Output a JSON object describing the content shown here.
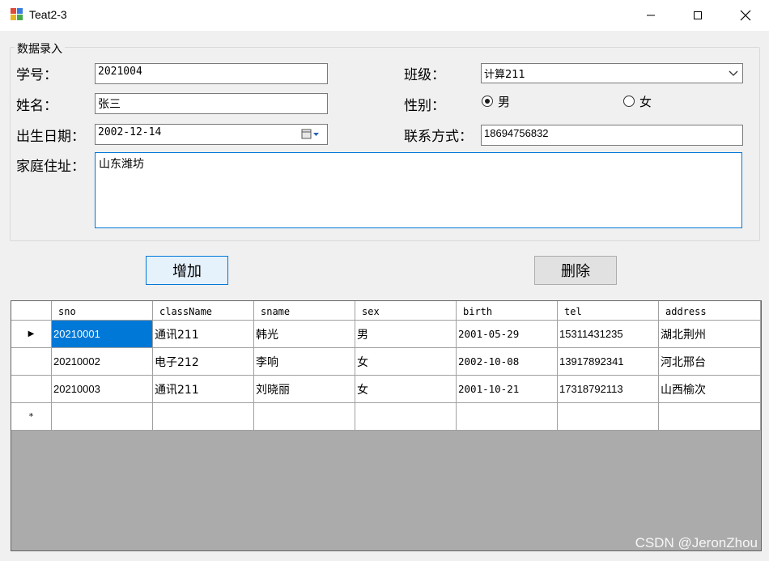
{
  "window": {
    "title": "Teat2-3",
    "icon": "winforms-app-icon"
  },
  "group": {
    "legend": "数据录入"
  },
  "form": {
    "sno_label": "学号：",
    "sno_value": "2021004",
    "name_label": "姓名：",
    "name_value": "张三",
    "birth_label": "出生日期：",
    "birth_value": "2002-12-14",
    "address_label": "家庭住址：",
    "address_value": "山东潍坊",
    "class_label": "班级：",
    "class_value": "计算211",
    "sex_label": "性别：",
    "sex_options": [
      {
        "label": "男",
        "checked": true
      },
      {
        "label": "女",
        "checked": false
      }
    ],
    "tel_label": "联系方式：",
    "tel_value": "18694756832"
  },
  "buttons": {
    "add": "增加",
    "delete": "删除"
  },
  "grid": {
    "columns": [
      "sno",
      "className",
      "sname",
      "sex",
      "birth",
      "tel",
      "address"
    ],
    "rows": [
      [
        "20210001",
        "通讯211",
        "韩光",
        "男",
        "2001-05-29",
        "15311431235",
        "湖北荆州"
      ],
      [
        "20210002",
        "电子212",
        "李响",
        "女",
        "2002-10-08",
        "13917892341",
        "河北邢台"
      ],
      [
        "20210003",
        "通讯211",
        "刘晓丽",
        "女",
        "2001-10-21",
        "17318792113",
        "山西榆次"
      ]
    ],
    "new_row_marker": "*",
    "current_row_marker": "▶"
  },
  "watermark": "CSDN @JeronZhou",
  "colors": {
    "selection": "#0078d7",
    "grid_background": "#ababab",
    "focus_border": "#0078d7"
  }
}
